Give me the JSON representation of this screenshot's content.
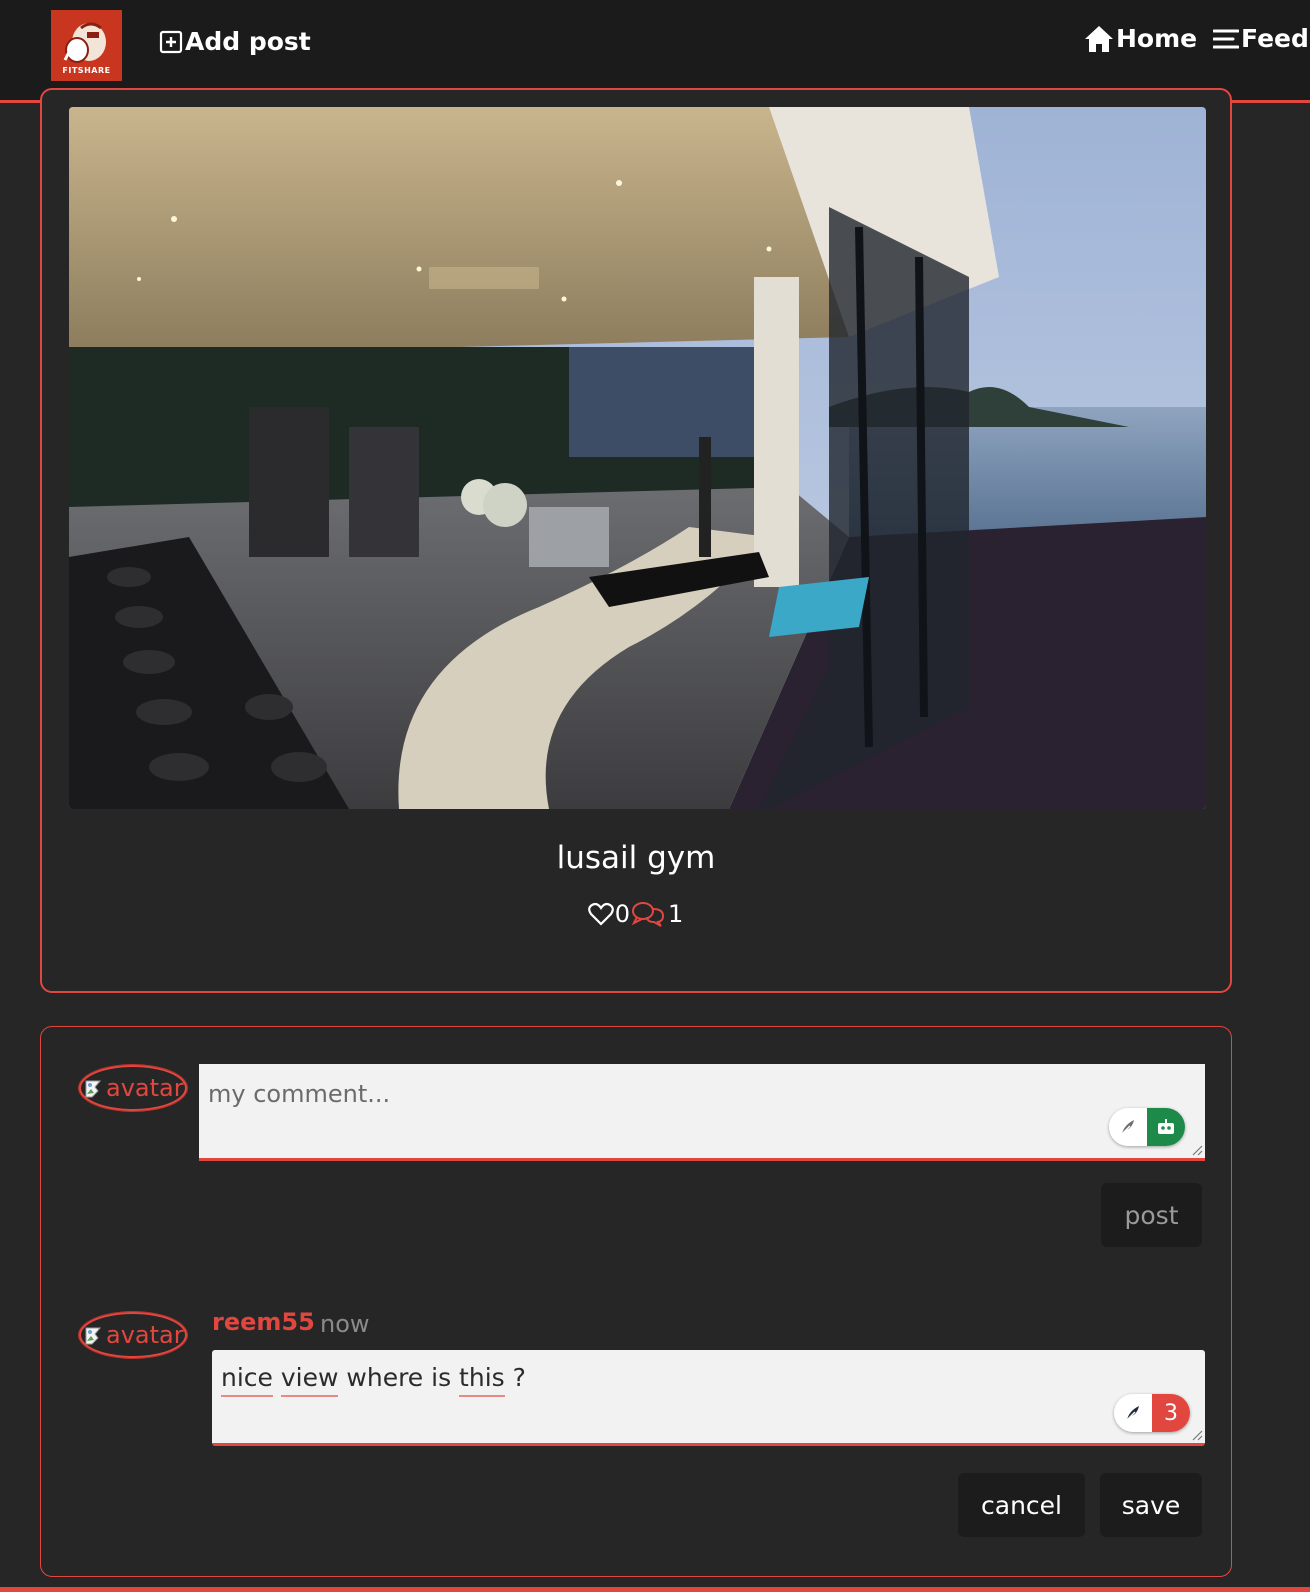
{
  "navbar": {
    "logo_text": "FITSHARE",
    "add_post_label": "Add post",
    "home_label": "Home",
    "feed_label": "Feed",
    "accent_color": "#e2473f"
  },
  "post": {
    "title": "lusail gym",
    "likes": "0",
    "comments": "1",
    "image_icon": "gym-photo"
  },
  "comment_form": {
    "avatar_alt": "avatar",
    "placeholder": "my comment...",
    "post_button": "post"
  },
  "comments": [
    {
      "avatar_alt": "avatar",
      "author": "reem55",
      "time": "now",
      "text_parts": [
        "nice",
        " ",
        "view",
        " where is ",
        "this",
        " ?"
      ],
      "grammar_count": "3",
      "cancel_label": "cancel",
      "save_label": "save"
    }
  ]
}
